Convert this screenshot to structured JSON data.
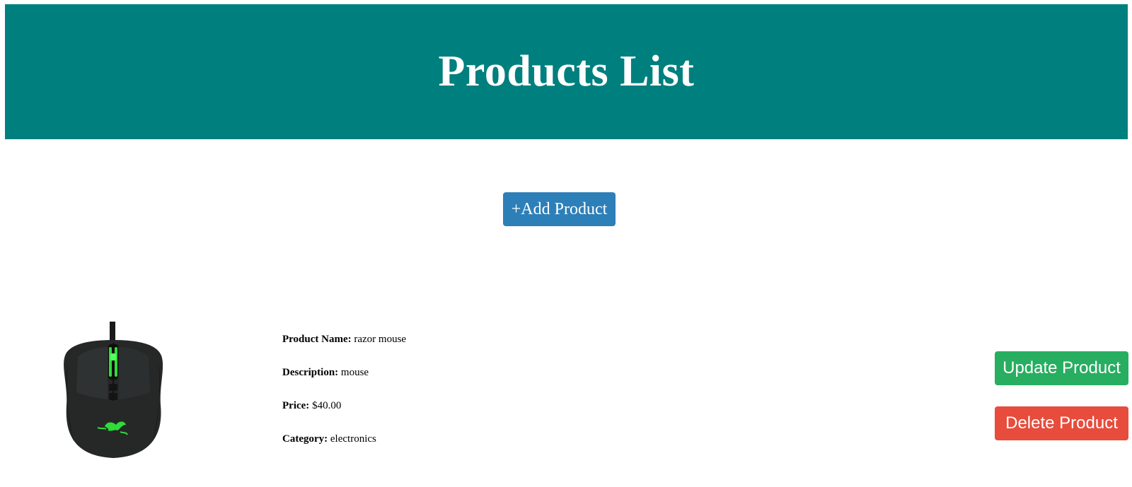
{
  "header": {
    "title": "Products List"
  },
  "actions": {
    "add_label": "+Add Product"
  },
  "products": [
    {
      "image_icon": "razer-mouse-image",
      "name_label": "Product Name:",
      "name": "razor mouse",
      "description_label": "Description:",
      "description": "mouse",
      "price_label": "Price:",
      "price": "$40.00",
      "category_label": "Category:",
      "category": "electronics",
      "update_label": "Update Product",
      "delete_label": "Delete Product"
    }
  ],
  "colors": {
    "header_bg": "#007f7f",
    "add_button": "#2d7fb8",
    "update_button": "#27ae60",
    "delete_button": "#e74c3c"
  }
}
